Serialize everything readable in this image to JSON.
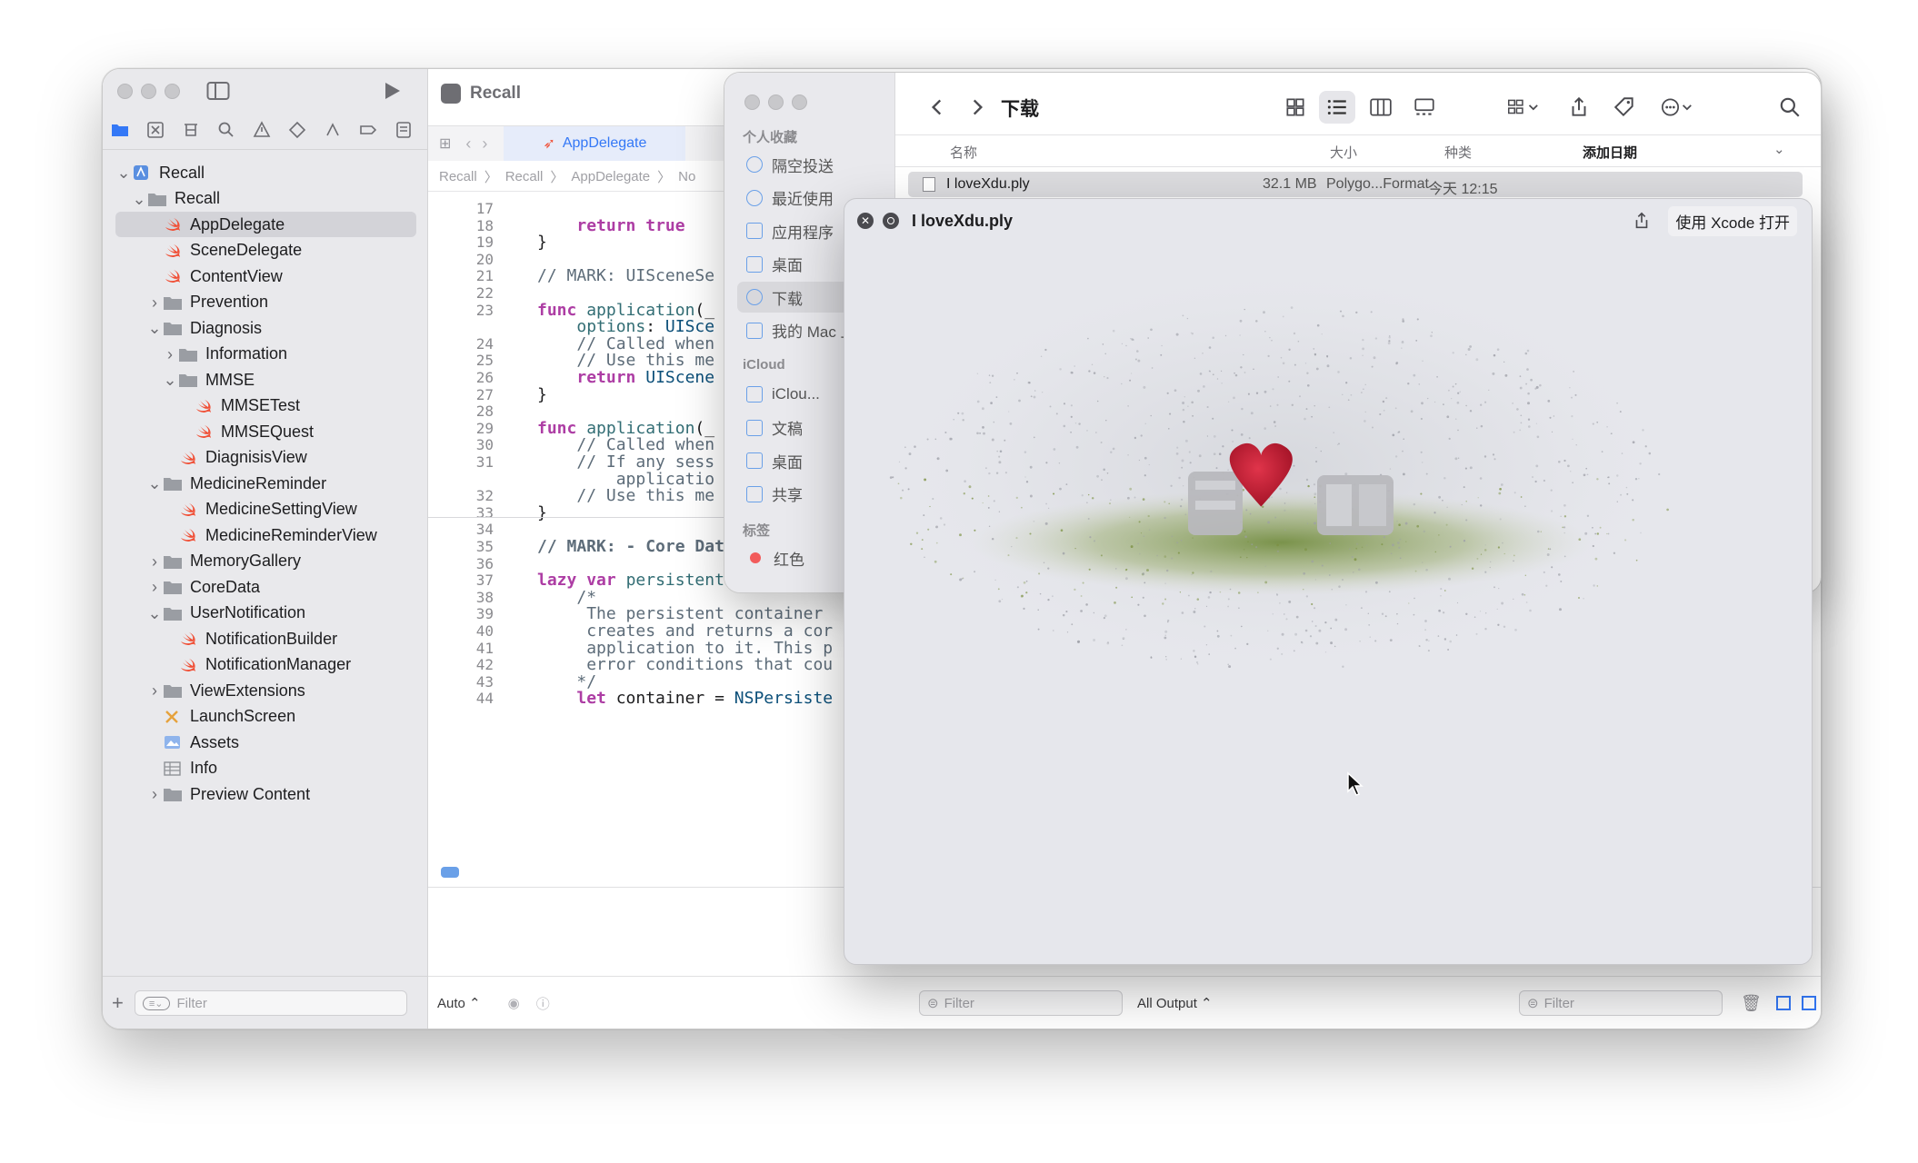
{
  "xcode": {
    "project_title": "Recall",
    "tabs": [
      "AppDelegate"
    ],
    "breadcrumb": [
      "Recall",
      "Recall",
      "AppDelegate",
      "No"
    ],
    "navigator_tree": [
      {
        "label": "Recall",
        "kind": "project",
        "level": 0,
        "expanded": true
      },
      {
        "label": "Recall",
        "kind": "folder",
        "level": 1,
        "expanded": true
      },
      {
        "label": "AppDelegate",
        "kind": "swift",
        "level": 2,
        "selected": true
      },
      {
        "label": "SceneDelegate",
        "kind": "swift",
        "level": 2
      },
      {
        "label": "ContentView",
        "kind": "swift",
        "level": 2
      },
      {
        "label": "Prevention",
        "kind": "folder",
        "level": 2,
        "expanded": false
      },
      {
        "label": "Diagnosis",
        "kind": "folder",
        "level": 2,
        "expanded": true
      },
      {
        "label": "Information",
        "kind": "folder",
        "level": 3,
        "expanded": false
      },
      {
        "label": "MMSE",
        "kind": "folder",
        "level": 3,
        "expanded": true
      },
      {
        "label": "MMSETest",
        "kind": "swift",
        "level": 4
      },
      {
        "label": "MMSEQuest",
        "kind": "swift",
        "level": 4
      },
      {
        "label": "DiagnisisView",
        "kind": "swift",
        "level": 3
      },
      {
        "label": "MedicineReminder",
        "kind": "folder",
        "level": 2,
        "expanded": true
      },
      {
        "label": "MedicineSettingView",
        "kind": "swift",
        "level": 3
      },
      {
        "label": "MedicineReminderView",
        "kind": "swift",
        "level": 3
      },
      {
        "label": "MemoryGallery",
        "kind": "folder",
        "level": 2,
        "expanded": false
      },
      {
        "label": "CoreData",
        "kind": "folder",
        "level": 2,
        "expanded": false
      },
      {
        "label": "UserNotification",
        "kind": "folder",
        "level": 2,
        "expanded": true
      },
      {
        "label": "NotificationBuilder",
        "kind": "swift",
        "level": 3
      },
      {
        "label": "NotificationManager",
        "kind": "swift",
        "level": 3
      },
      {
        "label": "ViewExtensions",
        "kind": "folder",
        "level": 2,
        "expanded": false
      },
      {
        "label": "LaunchScreen",
        "kind": "storyboard",
        "level": 2
      },
      {
        "label": "Assets",
        "kind": "assets",
        "level": 2
      },
      {
        "label": "Info",
        "kind": "plist",
        "level": 2
      },
      {
        "label": "Preview Content",
        "kind": "folder",
        "level": 2,
        "expanded": false
      }
    ],
    "code_lines": [
      {
        "n": "17",
        "html": ""
      },
      {
        "n": "18",
        "html": "    <span class='kw'>return</span> <span class='kw'>true</span>"
      },
      {
        "n": "19",
        "html": "}"
      },
      {
        "n": "20",
        "html": ""
      },
      {
        "n": "21",
        "html": "<span class='cm'>// MARK: UISceneSe</span>"
      },
      {
        "n": "22",
        "html": ""
      },
      {
        "n": "23",
        "html": "<span class='kw'>func</span> <span class='fn'>application</span>(_"
      },
      {
        "n": "",
        "html": "    <span class='fn'>options</span>: <span class='ty'>UISce</span>"
      },
      {
        "n": "24",
        "html": "    <span class='cm'>// Called when</span>"
      },
      {
        "n": "25",
        "html": "    <span class='cm'>// Use this me</span>"
      },
      {
        "n": "26",
        "html": "    <span class='kw'>return</span> <span class='ty'>UIScene</span>"
      },
      {
        "n": "27",
        "html": "}"
      },
      {
        "n": "28",
        "html": ""
      },
      {
        "n": "29",
        "html": "<span class='kw'>func</span> <span class='fn'>application</span>(_"
      },
      {
        "n": "30",
        "html": "    <span class='cm'>// Called when</span>"
      },
      {
        "n": "31",
        "html": "    <span class='cm'>// If any sess</span>"
      },
      {
        "n": "",
        "html": "    <span class='cm'>    applicatio</span>"
      },
      {
        "n": "32",
        "html": "    <span class='cm'>// Use this me</span>"
      },
      {
        "n": "33",
        "html": "}"
      },
      {
        "n": "34",
        "html": ""
      },
      {
        "n": "35",
        "html": "<span class='cm'><b>// MARK: - Core Data stack</b></span>"
      },
      {
        "n": "36",
        "html": ""
      },
      {
        "n": "37",
        "html": "<span class='kw'>lazy</span> <span class='kw'>var</span> <span class='fn'>persistentContainer</span>:"
      },
      {
        "n": "38",
        "html": "    <span class='cm'>/*</span>"
      },
      {
        "n": "39",
        "html": "    <span class='cm'> The persistent container</span>"
      },
      {
        "n": "40",
        "html": "    <span class='cm'> creates and returns a cor</span>"
      },
      {
        "n": "41",
        "html": "    <span class='cm'> application to it. This p</span>"
      },
      {
        "n": "42",
        "html": "    <span class='cm'> error conditions that cou</span>"
      },
      {
        "n": "43",
        "html": "    <span class='cm'>*/</span>"
      },
      {
        "n": "44",
        "html": "    <span class='kw'>let</span> container = <span class='ty'>NSPersiste</span>"
      }
    ],
    "filter_placeholder": "Filter",
    "debug_auto": "Auto ⌃",
    "debug_filter_placeholder": "Filter",
    "output_select": "All Output ⌃",
    "output_filter_placeholder": "Filter"
  },
  "finder": {
    "title": "下载",
    "sidebar": {
      "favorites_heading": "个人收藏",
      "favorites": [
        "隔空投送",
        "最近使用",
        "应用程序",
        "桌面",
        "下载",
        "我的 Mac 上"
      ],
      "icloud_heading": "iCloud",
      "icloud": [
        "iClou...",
        "文稿",
        "桌面",
        "共享"
      ],
      "tags_heading": "标签",
      "tags": [
        "红色"
      ]
    },
    "columns": [
      "名称",
      "大小",
      "种类",
      "添加日期"
    ],
    "files": [
      {
        "name": "I loveXdu.ply",
        "size": "32.1 MB",
        "kind": "Polygo...Format",
        "date": "今天 12:15"
      }
    ]
  },
  "quicklook": {
    "title": "I loveXdu.ply",
    "open_button": "使用 Xcode 打开"
  },
  "colors": {
    "accent": "#3478f6",
    "swift": "#f05138"
  }
}
